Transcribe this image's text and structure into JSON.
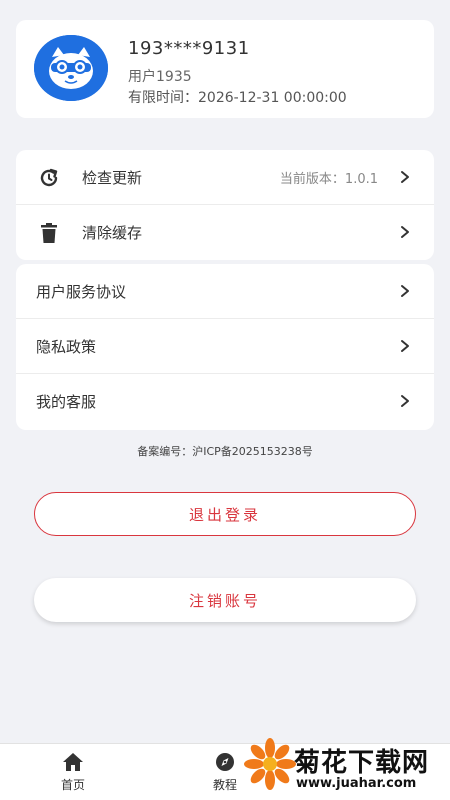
{
  "profile": {
    "phone": "193****9131",
    "username": "用户1935",
    "expire_text": "有限时间：2026-12-31 00:00:00"
  },
  "settings": {
    "check_update": {
      "label": "检查更新",
      "value": "当前版本：1.0.1",
      "icon": "refresh-icon"
    },
    "clear_cache": {
      "label": "清除缓存",
      "icon": "trash-icon"
    }
  },
  "links": {
    "user_agreement": "用户服务协议",
    "privacy_policy": "隐私政策",
    "customer_service": "我的客服"
  },
  "icp": "备案编号：沪ICP备2025153238号",
  "buttons": {
    "logout": "退出登录",
    "delete_account": "注销账号"
  },
  "tabbar": {
    "home": {
      "label": "首页",
      "icon": "home-icon"
    },
    "guide": {
      "label": "教程",
      "icon": "compass-icon"
    }
  },
  "watermark": {
    "title": "菊花下载网",
    "url": "www.juahar.com"
  },
  "colors": {
    "accent": "#d9363e",
    "background": "#f1f2f6",
    "avatar": "#1f6fe0",
    "watermark_flower": "#f07a1a"
  }
}
